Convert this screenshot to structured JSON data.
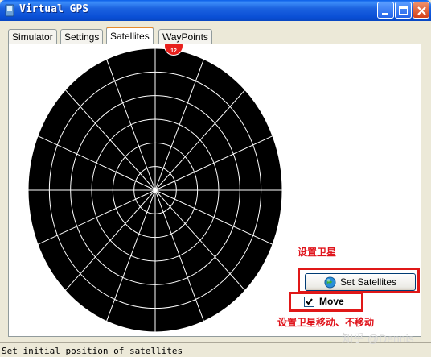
{
  "window": {
    "title": "Virtual GPS"
  },
  "tabs": [
    {
      "label": "Simulator",
      "active": false
    },
    {
      "label": "Settings",
      "active": false
    },
    {
      "label": "Satellites",
      "active": true
    },
    {
      "label": "WayPoints",
      "active": false
    }
  ],
  "radar": {
    "ring_count": 6,
    "spoke_count": 16,
    "background_color": "#000000",
    "line_color": "#ffffff"
  },
  "satellite_marker": {
    "label": "12",
    "color": "#e8201c"
  },
  "annotations": {
    "set_satellites_note": "设置卫星",
    "move_note": "设置卫星移动、不移动",
    "highlight_color": "#e01818"
  },
  "controls": {
    "set_satellites_label": "Set Satellites",
    "move_label": "Move",
    "move_checked": true
  },
  "statusbar": {
    "text": "Set initial position of satellites"
  },
  "watermark": "知乎 @Dennis"
}
